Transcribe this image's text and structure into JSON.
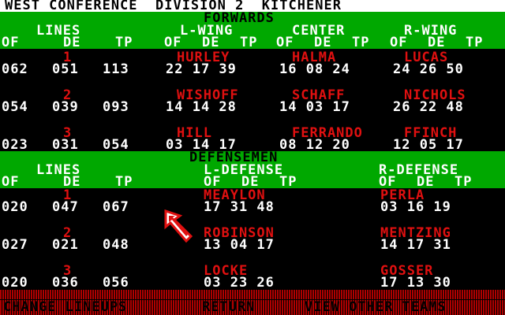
{
  "header": {
    "title": "WEST CONFERENCE  DIVISION 2  KITCHENER"
  },
  "forwards": {
    "section_label": "FORWARDS",
    "group_headers": [
      "LINES",
      "L-WING",
      "CENTER",
      "R-WING"
    ],
    "col_headers": [
      "OF",
      "DE",
      "TP"
    ],
    "lines": [
      {
        "num": "1",
        "of": "062",
        "de": "051",
        "tp": "113",
        "lw": {
          "name": "HURLEY",
          "stats": "22 17 39"
        },
        "c": {
          "name": "HALMA",
          "stats": "16 08 24"
        },
        "rw": {
          "name": "LUCAS",
          "stats": "24 26 50"
        }
      },
      {
        "num": "2",
        "of": "054",
        "de": "039",
        "tp": "093",
        "lw": {
          "name": "WISHOFF",
          "stats": "14 14 28"
        },
        "c": {
          "name": "SCHAFF",
          "stats": "14 03 17"
        },
        "rw": {
          "name": "NICHOLS",
          "stats": "26 22 48"
        }
      },
      {
        "num": "3",
        "of": "023",
        "de": "031",
        "tp": "054",
        "lw": {
          "name": "HILL",
          "stats": "03 14 17"
        },
        "c": {
          "name": "FERRANDO",
          "stats": "08 12 20"
        },
        "rw": {
          "name": "FFINCH",
          "stats": "12 05 17"
        }
      }
    ]
  },
  "defensemen": {
    "section_label": "DEFENSEMEN",
    "group_headers": [
      "LINES",
      "L-DEFENSE",
      "R-DEFENSE"
    ],
    "col_headers": [
      "OF",
      "DE",
      "TP"
    ],
    "lines": [
      {
        "num": "1",
        "of": "020",
        "de": "047",
        "tp": "067",
        "ld": {
          "name": "MEAYLON",
          "stats": "17 31 48"
        },
        "rd": {
          "name": "PERLA",
          "stats": "03 16 19"
        }
      },
      {
        "num": "2",
        "of": "027",
        "de": "021",
        "tp": "048",
        "ld": {
          "name": "ROBINSON",
          "stats": "13 04 17"
        },
        "rd": {
          "name": "MENTZING",
          "stats": "14 17 31"
        }
      },
      {
        "num": "3",
        "of": "020",
        "de": "036",
        "tp": "056",
        "ld": {
          "name": "LOCKE",
          "stats": "03 23 26"
        },
        "rd": {
          "name": "GOSSER",
          "stats": "17 13 30"
        }
      }
    ]
  },
  "menu": {
    "change": "CHANGE LINEUPS",
    "return": "RETURN",
    "view": "VIEW OTHER TEAMS"
  },
  "colors": {
    "green": "#00a800",
    "red": "#e01010",
    "white": "#ffffff"
  }
}
